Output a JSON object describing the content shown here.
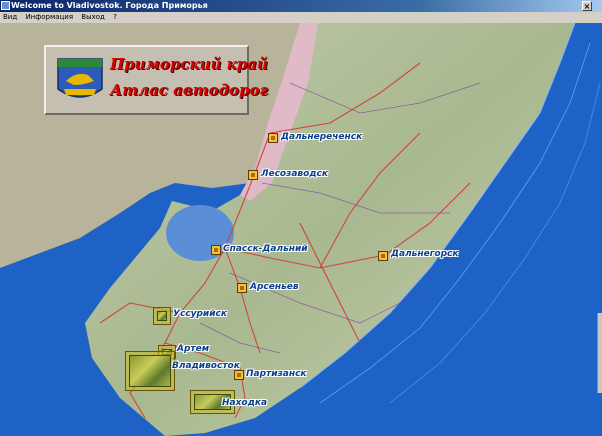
{
  "window": {
    "title": "Welcome to Vladivostok. Города Приморья",
    "close_label": "×"
  },
  "menu": {
    "items": [
      "Вид",
      "Информация",
      "Выход",
      "?"
    ]
  },
  "banner": {
    "line1": "Приморский край",
    "line2": "Атлас автодорог"
  },
  "cities": [
    {
      "name": "Дальнереченск"
    },
    {
      "name": "Лесозаводск"
    },
    {
      "name": "Спасск-Дальний"
    },
    {
      "name": "Дальнегорск"
    },
    {
      "name": "Арсеньев"
    },
    {
      "name": "Уссурийск"
    },
    {
      "name": "Артем"
    },
    {
      "name": "Владивосток"
    },
    {
      "name": "Партизанск"
    },
    {
      "name": "Находка"
    }
  ],
  "colors": {
    "sea": "#1d62c4",
    "land": "#b9c7a3",
    "neighbor": "#b8b49c",
    "roads": "#d0463a",
    "lake": "#5a8fd8",
    "city_label": "#0a3e8e",
    "banner_text": "#d90000"
  }
}
